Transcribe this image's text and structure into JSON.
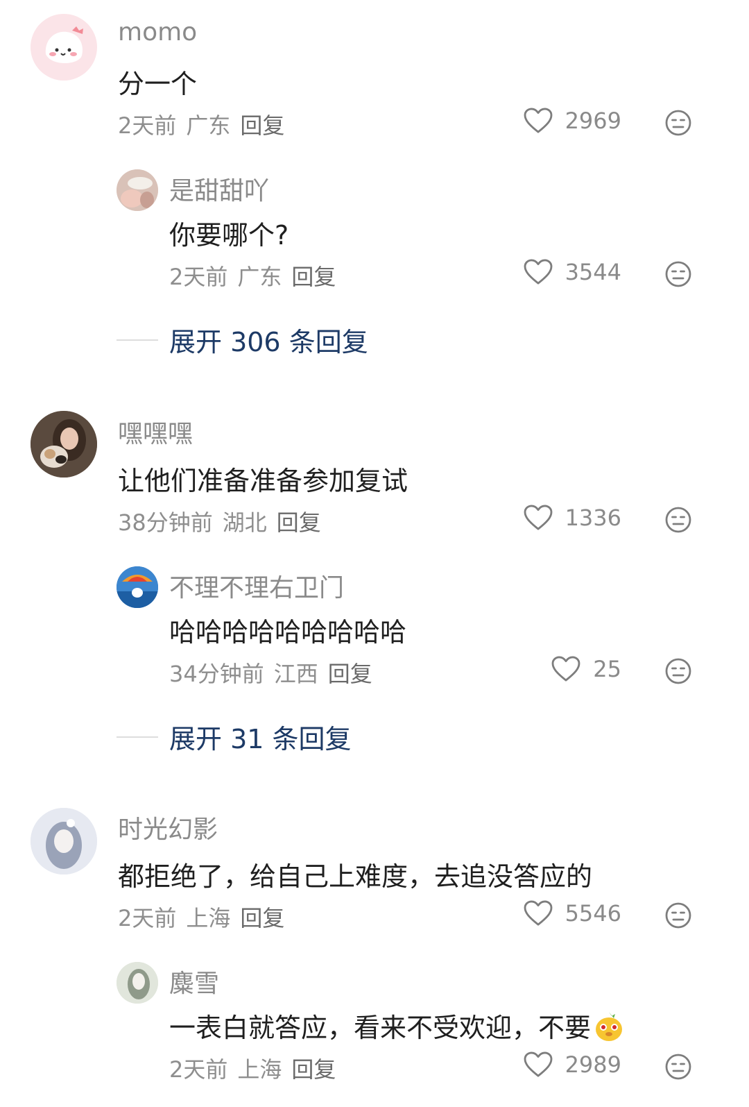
{
  "comments": [
    {
      "user": "momo",
      "avatar_icon": "pink-cartoon-avatar",
      "text": "分一个",
      "time": "2天前",
      "location": "广东",
      "reply_label": "回复",
      "likes": "2969",
      "replies": [
        {
          "user": "是甜甜吖",
          "avatar_icon": "photo-avatar",
          "text": "你要哪个?",
          "time": "2天前",
          "location": "广东",
          "reply_label": "回复",
          "likes": "3544"
        }
      ],
      "expand_label": "展开 306 条回复"
    },
    {
      "user": "嘿嘿嘿",
      "avatar_icon": "girl-with-cat-avatar",
      "text": "让他们准备准备参加复试",
      "time": "38分钟前",
      "location": "湖北",
      "reply_label": "回复",
      "likes": "1336",
      "replies": [
        {
          "user": "不理不理右卫门",
          "avatar_icon": "parachute-cat-avatar",
          "text": "哈哈哈哈哈哈哈哈哈",
          "time": "34分钟前",
          "location": "江西",
          "reply_label": "回复",
          "likes": "25"
        }
      ],
      "expand_label": "展开 31 条回复"
    },
    {
      "user": "时光幻影",
      "avatar_icon": "anime-girl-avatar",
      "text": "都拒绝了，给自己上难度，去追没答应的",
      "time": "2天前",
      "location": "上海",
      "reply_label": "回复",
      "likes": "5546",
      "replies": [
        {
          "user": "麋雪",
          "avatar_icon": "sketch-girl-avatar",
          "text": "一表白就答应，看来不受欢迎，不要",
          "emoji_icon": "yellow-bird-emoji",
          "time": "2天前",
          "location": "上海",
          "reply_label": "回复",
          "likes": "2989"
        }
      ]
    }
  ],
  "colors": {
    "username": "#8a8a8a",
    "text": "#1f1f1f",
    "meta": "#8e8e8e",
    "expand": "#1d3a66"
  }
}
